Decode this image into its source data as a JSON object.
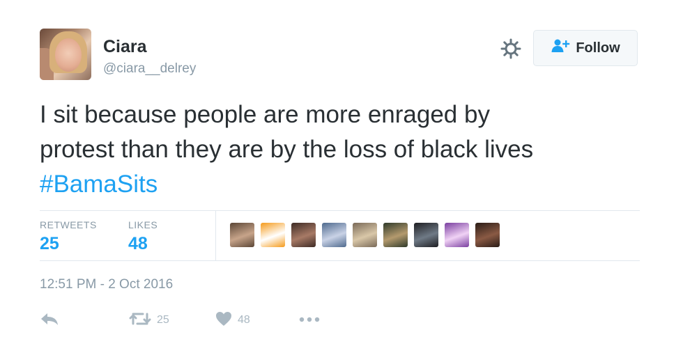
{
  "author": {
    "name": "Ciara",
    "handle": "@ciara__delrey"
  },
  "follow_button": {
    "label": "Follow"
  },
  "tweet": {
    "line1": "I sit because people are more enraged by",
    "line2": "protest than they are by the loss of black lives",
    "hashtag": "#BamaSits"
  },
  "stats": {
    "retweets_label": "RETWEETS",
    "retweets_value": "25",
    "likes_label": "LIKES",
    "likes_value": "48"
  },
  "likers": [
    {
      "name": "liker-avatar-1",
      "colors": [
        "#5b4636",
        "#c7a48a"
      ]
    },
    {
      "name": "liker-avatar-2",
      "colors": [
        "#f59b1c",
        "#ffffff"
      ]
    },
    {
      "name": "liker-avatar-3",
      "colors": [
        "#3e2b25",
        "#a77a66"
      ]
    },
    {
      "name": "liker-avatar-4",
      "colors": [
        "#4f6a8e",
        "#c9d2e6"
      ]
    },
    {
      "name": "liker-avatar-5",
      "colors": [
        "#7a6a58",
        "#d9c7a8"
      ]
    },
    {
      "name": "liker-avatar-6",
      "colors": [
        "#2f3a2a",
        "#b49a6e"
      ]
    },
    {
      "name": "liker-avatar-7",
      "colors": [
        "#1e1e22",
        "#6f7a86"
      ]
    },
    {
      "name": "liker-avatar-8",
      "colors": [
        "#7a3fa0",
        "#f0d2f5"
      ]
    },
    {
      "name": "liker-avatar-9",
      "colors": [
        "#2a1c16",
        "#8a5a44"
      ]
    }
  ],
  "timestamp": "12:51 PM - 2 Oct 2016",
  "actions": {
    "retweet_count": "25",
    "like_count": "48"
  },
  "colors": {
    "accent": "#1da1f2",
    "text": "#292f33",
    "muted": "#8899a6",
    "icon": "#aab8c2",
    "border": "#e1e8ed"
  }
}
